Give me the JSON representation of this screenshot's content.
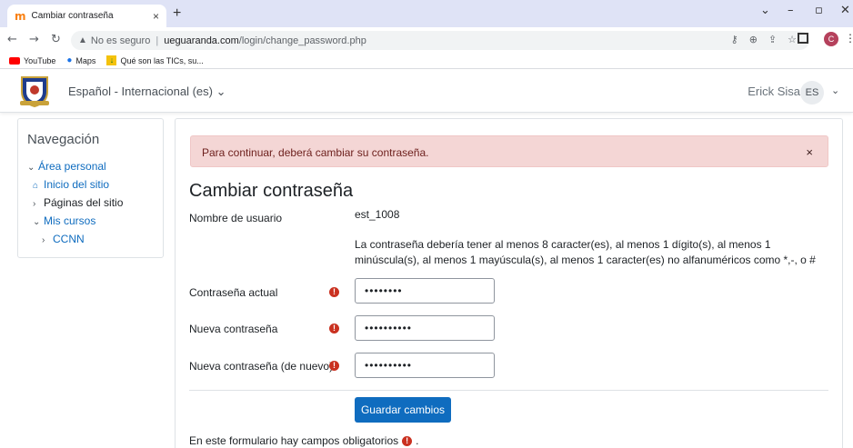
{
  "browser": {
    "tab_title": "Cambiar contraseña",
    "tab_close": "×",
    "new_tab": "+",
    "address_security": "No es seguro",
    "address_host": "ueguaranda.com",
    "address_path": "/login/change_password.php",
    "profile_initial": "C",
    "bookmarks": [
      {
        "label": "YouTube",
        "icon": "youtube-icon"
      },
      {
        "label": "Maps",
        "icon": "maps-pin-icon"
      },
      {
        "label": "Qué son las TICs, su...",
        "icon": "download-bookmark-icon"
      }
    ]
  },
  "navbar": {
    "language": "Español - Internacional (es) ⌄",
    "user_name": "Erick Sisa",
    "user_initials": "ES"
  },
  "sidebar": {
    "heading": "Navegación",
    "items": [
      {
        "label": "Área personal",
        "chevron": "⌄"
      },
      {
        "label": "Inicio del sitio",
        "icon": "home-icon"
      },
      {
        "label": "Páginas del sitio",
        "chevron": "›"
      },
      {
        "label": "Mis cursos",
        "chevron": "⌄"
      },
      {
        "label": "CCNN",
        "chevron": "›"
      }
    ]
  },
  "main": {
    "alert_text": "Para continuar, deberá cambiar su contraseña.",
    "alert_close": "×",
    "title": "Cambiar contraseña",
    "username_label": "Nombre de usuario",
    "username_value": "est_1008",
    "password_policy": "La contraseña debería tener al menos 8 caracter(es), al menos 1 dígito(s), al menos 1 minúscula(s), al menos 1 mayúscula(s), al menos 1 caracter(es) no alfanuméricos como *,-, o #",
    "fields": [
      {
        "label": "Contraseña actual",
        "value": "••••••••"
      },
      {
        "label": "Nueva contraseña",
        "value": "••••••••••"
      },
      {
        "label": "Nueva contraseña (de nuevo)",
        "value": "••••••••••"
      }
    ],
    "required_icon": "!",
    "save_button": "Guardar cambios",
    "required_note": "En este formulario hay campos obligatorios",
    "required_note_end": "."
  },
  "colors": {
    "primary": "#0f6cbf",
    "alert_bg": "#f4d6d5",
    "required": "#ca3120"
  }
}
